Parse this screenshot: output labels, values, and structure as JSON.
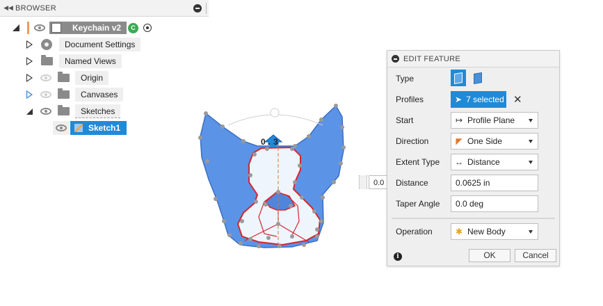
{
  "browser": {
    "title": "BROWSER",
    "root": {
      "label": "Keychain v2"
    },
    "items": [
      {
        "label": "Document Settings"
      },
      {
        "label": "Named Views"
      },
      {
        "label": "Origin"
      },
      {
        "label": "Canvases"
      },
      {
        "label": "Sketches"
      }
    ],
    "sketch": {
      "label": "Sketch1"
    }
  },
  "canvas": {
    "distance_input": "0.0",
    "manipulator_label": "0.3"
  },
  "edit_feature": {
    "title": "EDIT FEATURE",
    "type_label": "Type",
    "profiles_label": "Profiles",
    "profiles_value": "7 selected",
    "start_label": "Start",
    "start_value": "Profile Plane",
    "direction_label": "Direction",
    "direction_value": "One Side",
    "extent_label": "Extent Type",
    "extent_value": "Distance",
    "distance_label": "Distance",
    "distance_value": "0.0625 in",
    "taper_label": "Taper Angle",
    "taper_value": "0.0 deg",
    "operation_label": "Operation",
    "operation_value": "New Body",
    "ok_label": "OK",
    "cancel_label": "Cancel"
  },
  "colors": {
    "accent": "#1f8ad8",
    "body_fill": "#5b93e6",
    "profile_outline": "#d4262d"
  }
}
